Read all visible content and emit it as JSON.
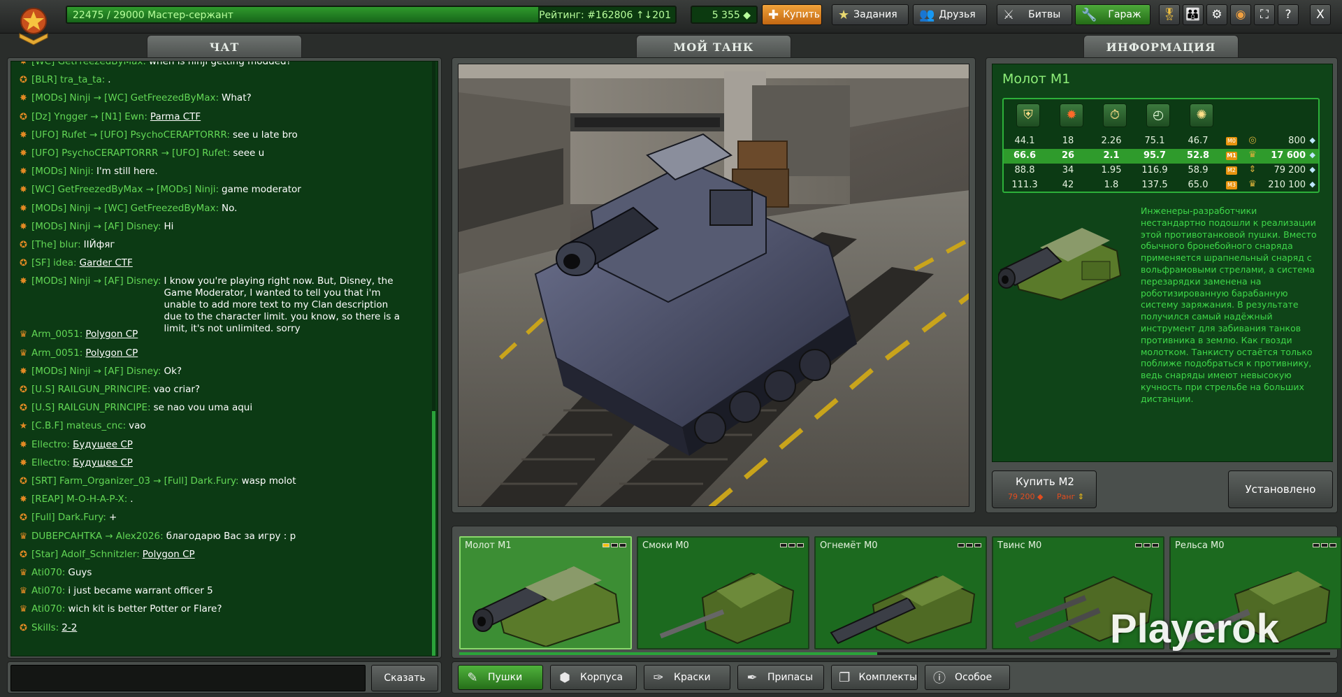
{
  "topbar": {
    "xp_text": "22475 / 29000  Мастер-сержант",
    "xp_fraction": 0.775,
    "rating_text": "Рейтинг: #162806  ↑↓201",
    "crystals": "5 355 ◆",
    "buttons": {
      "buy": "Купить",
      "missions": "Задания",
      "friends": "Друзья",
      "battles": "Битвы",
      "garage": "Гараж"
    },
    "icon_buttons": [
      "achievements-icon",
      "friends-settings-icon",
      "gear-icon",
      "sound-icon",
      "fullscreen-icon",
      "help-icon",
      "close-icon"
    ],
    "close_label": "X",
    "help_label": "?"
  },
  "tabs": {
    "chat": "ЧАТ",
    "my_tank": "МОЙ ТАНК",
    "info": "ИНФОРМАЦИЯ"
  },
  "chat": {
    "lines": [
      {
        "sender": "[WC] GetFreezedByMax:",
        "to": "",
        "text": "when is ninji getting modded?",
        "link": false
      },
      {
        "sender": "[BLR] tra_ta_ta:",
        "to": "",
        "text": ".",
        "link": false
      },
      {
        "sender": "[MODs] Ninji →",
        "to": "[WC] GetFreezedByMax:",
        "text": "What?",
        "link": false
      },
      {
        "sender": "[Dz] Yngger →",
        "to": "[N1] Ewn:",
        "text": "Parma CTF",
        "link": true
      },
      {
        "sender": "[UFO] Rufet →",
        "to": "[UFO] PsychoCERAPTORRR:",
        "text": "see u late bro",
        "link": false
      },
      {
        "sender": "[UFO] PsychoCERAPTORRR →",
        "to": "[UFO] Rufet:",
        "text": "seee u",
        "link": false
      },
      {
        "sender": "[MODs] Ninji:",
        "to": "",
        "text": "I'm still here.",
        "link": false
      },
      {
        "sender": "[WC] GetFreezedByMax →",
        "to": "[MODs] Ninji:",
        "text": "game moderator",
        "link": false
      },
      {
        "sender": "[MODs] Ninji →",
        "to": "[WC] GetFreezedByMax:",
        "text": "No.",
        "link": false
      },
      {
        "sender": "[MODs] Ninji →",
        "to": "[AF] Disney:",
        "text": "Hi",
        "link": false
      },
      {
        "sender": "[The] blur:",
        "to": "",
        "text": "IIЙфяг",
        "link": false
      },
      {
        "sender": "[SF] idea:",
        "to": "",
        "text": "Garder CTF",
        "link": true
      },
      {
        "sender": "[MODs] Ninji →",
        "to": "[AF] Disney:",
        "text": "I know you're playing right now. But, Disney, the Game Moderator, I wanted to tell you that i'm unable to add more text to my Clan description due to the character limit. you know, so there is a limit, it's not unlimited. sorry",
        "link": false
      },
      {
        "sender": "Arm_0051:",
        "to": "",
        "text": "Polygon CP",
        "link": true
      },
      {
        "sender": "Arm_0051:",
        "to": "",
        "text": "Polygon CP",
        "link": true
      },
      {
        "sender": "[MODs] Ninji →",
        "to": "[AF] Disney:",
        "text": "Ok?",
        "link": false
      },
      {
        "sender": "[U.S] RAILGUN_PRINCIPE:",
        "to": "",
        "text": "vao criar?",
        "link": false
      },
      {
        "sender": "[U.S] RAILGUN_PRINCIPE:",
        "to": "",
        "text": "se nao vou uma aqui",
        "link": false
      },
      {
        "sender": "[C.B.F] mateus_cnc:",
        "to": "",
        "text": "vao",
        "link": false
      },
      {
        "sender": "Ellectro:",
        "to": "",
        "text": "Будущее CP",
        "link": true
      },
      {
        "sender": "Ellectro:",
        "to": "",
        "text": "Будущее CP",
        "link": true
      },
      {
        "sender": "[SRT] Farm_Organizer_03 →",
        "to": "[Full] Dark.Fury:",
        "text": "wasp molot",
        "link": false
      },
      {
        "sender": "[REAP] M-O-H-A-P-X:",
        "to": "",
        "text": ".",
        "link": false
      },
      {
        "sender": "[Full] Dark.Fury:",
        "to": "",
        "text": "+",
        "link": false
      },
      {
        "sender": "DUBEPCAHTKA →",
        "to": "Alex2026:",
        "text": "благодарю Вас за игру : р",
        "link": false
      },
      {
        "sender": "[Star] Adolf_Schnitzler:",
        "to": "",
        "text": "Polygon CP",
        "link": true
      },
      {
        "sender": "Ati070:",
        "to": "",
        "text": "Guys",
        "link": false
      },
      {
        "sender": "Ati070:",
        "to": "",
        "text": "i just became warrant officer 5",
        "link": false
      },
      {
        "sender": "Ati070:",
        "to": "",
        "text": "wich kit is better Potter or Flare?",
        "link": false
      },
      {
        "sender": "Skills:",
        "to": "",
        "text": "2-2",
        "link": true
      }
    ],
    "input_value": "",
    "send_label": "Сказать"
  },
  "info": {
    "title": "Молот М1",
    "stat_icons": [
      "armor-piercing-icon",
      "damage-icon",
      "reload-icon",
      "rotation-speed-icon",
      "impact-force-icon"
    ],
    "rows": [
      {
        "v": [
          "44.1",
          "18",
          "2.26",
          "75.1",
          "46.7"
        ],
        "mod": "M0",
        "price": "800",
        "active": false
      },
      {
        "v": [
          "66.6",
          "26",
          "2.1",
          "95.7",
          "52.8"
        ],
        "mod": "M1",
        "price": "17 600",
        "active": true
      },
      {
        "v": [
          "88.8",
          "34",
          "1.95",
          "116.9",
          "58.9"
        ],
        "mod": "M2",
        "price": "79 200",
        "active": false
      },
      {
        "v": [
          "111.3",
          "42",
          "1.8",
          "137.5",
          "65.0"
        ],
        "mod": "M3",
        "price": "210 100",
        "active": false
      }
    ],
    "crystal_glyph": "◆",
    "description": "Инженеры-разработчики нестандартно подошли к реализации этой противотанковой пушки. Вместо обычного бронебойного снаряда применяется шрапнельный снаряд с вольфрамовыми стрелами, а система перезарядки заменена на роботизированную барабанную систему заряжания. В результате получился самый надёжный инструмент для забивания танков противника в землю. Как гвозди молотком. Танкисту остаётся только поближе подобраться к противнику, ведь снаряды имеют невысокую кучность при стрельбе на больших дистанции.",
    "buy_label": "Купить М2",
    "buy_price": "79 200 ◆",
    "buy_rank": "Ранг",
    "installed_label": "Установлено"
  },
  "items": [
    {
      "name": "Молот М1",
      "level": 1,
      "selected": true
    },
    {
      "name": "Смоки М0",
      "level": 0,
      "selected": false
    },
    {
      "name": "Огнемёт М0",
      "level": 0,
      "selected": false
    },
    {
      "name": "Твинс М0",
      "level": 0,
      "selected": false
    },
    {
      "name": "Рельса М0",
      "level": 0,
      "selected": false
    }
  ],
  "items_scroll_fraction": 0.48,
  "categories": [
    {
      "label": "Пушки",
      "icon": "cannon-icon",
      "active": true
    },
    {
      "label": "Корпуса",
      "icon": "hull-icon",
      "active": false
    },
    {
      "label": "Краски",
      "icon": "paint-icon",
      "active": false
    },
    {
      "label": "Припасы",
      "icon": "supplies-icon",
      "active": false
    },
    {
      "label": "Комплекты",
      "icon": "kits-icon",
      "active": false
    },
    {
      "label": "Особое",
      "icon": "special-icon",
      "active": false
    }
  ],
  "watermark": "Playerok",
  "colors": {
    "chat_name": "#63d856",
    "chat_bg": "#0c3a14",
    "accent_green": "#2f9b2c",
    "buy_orange": "#e08a22",
    "price_red": "#e34d1f"
  }
}
